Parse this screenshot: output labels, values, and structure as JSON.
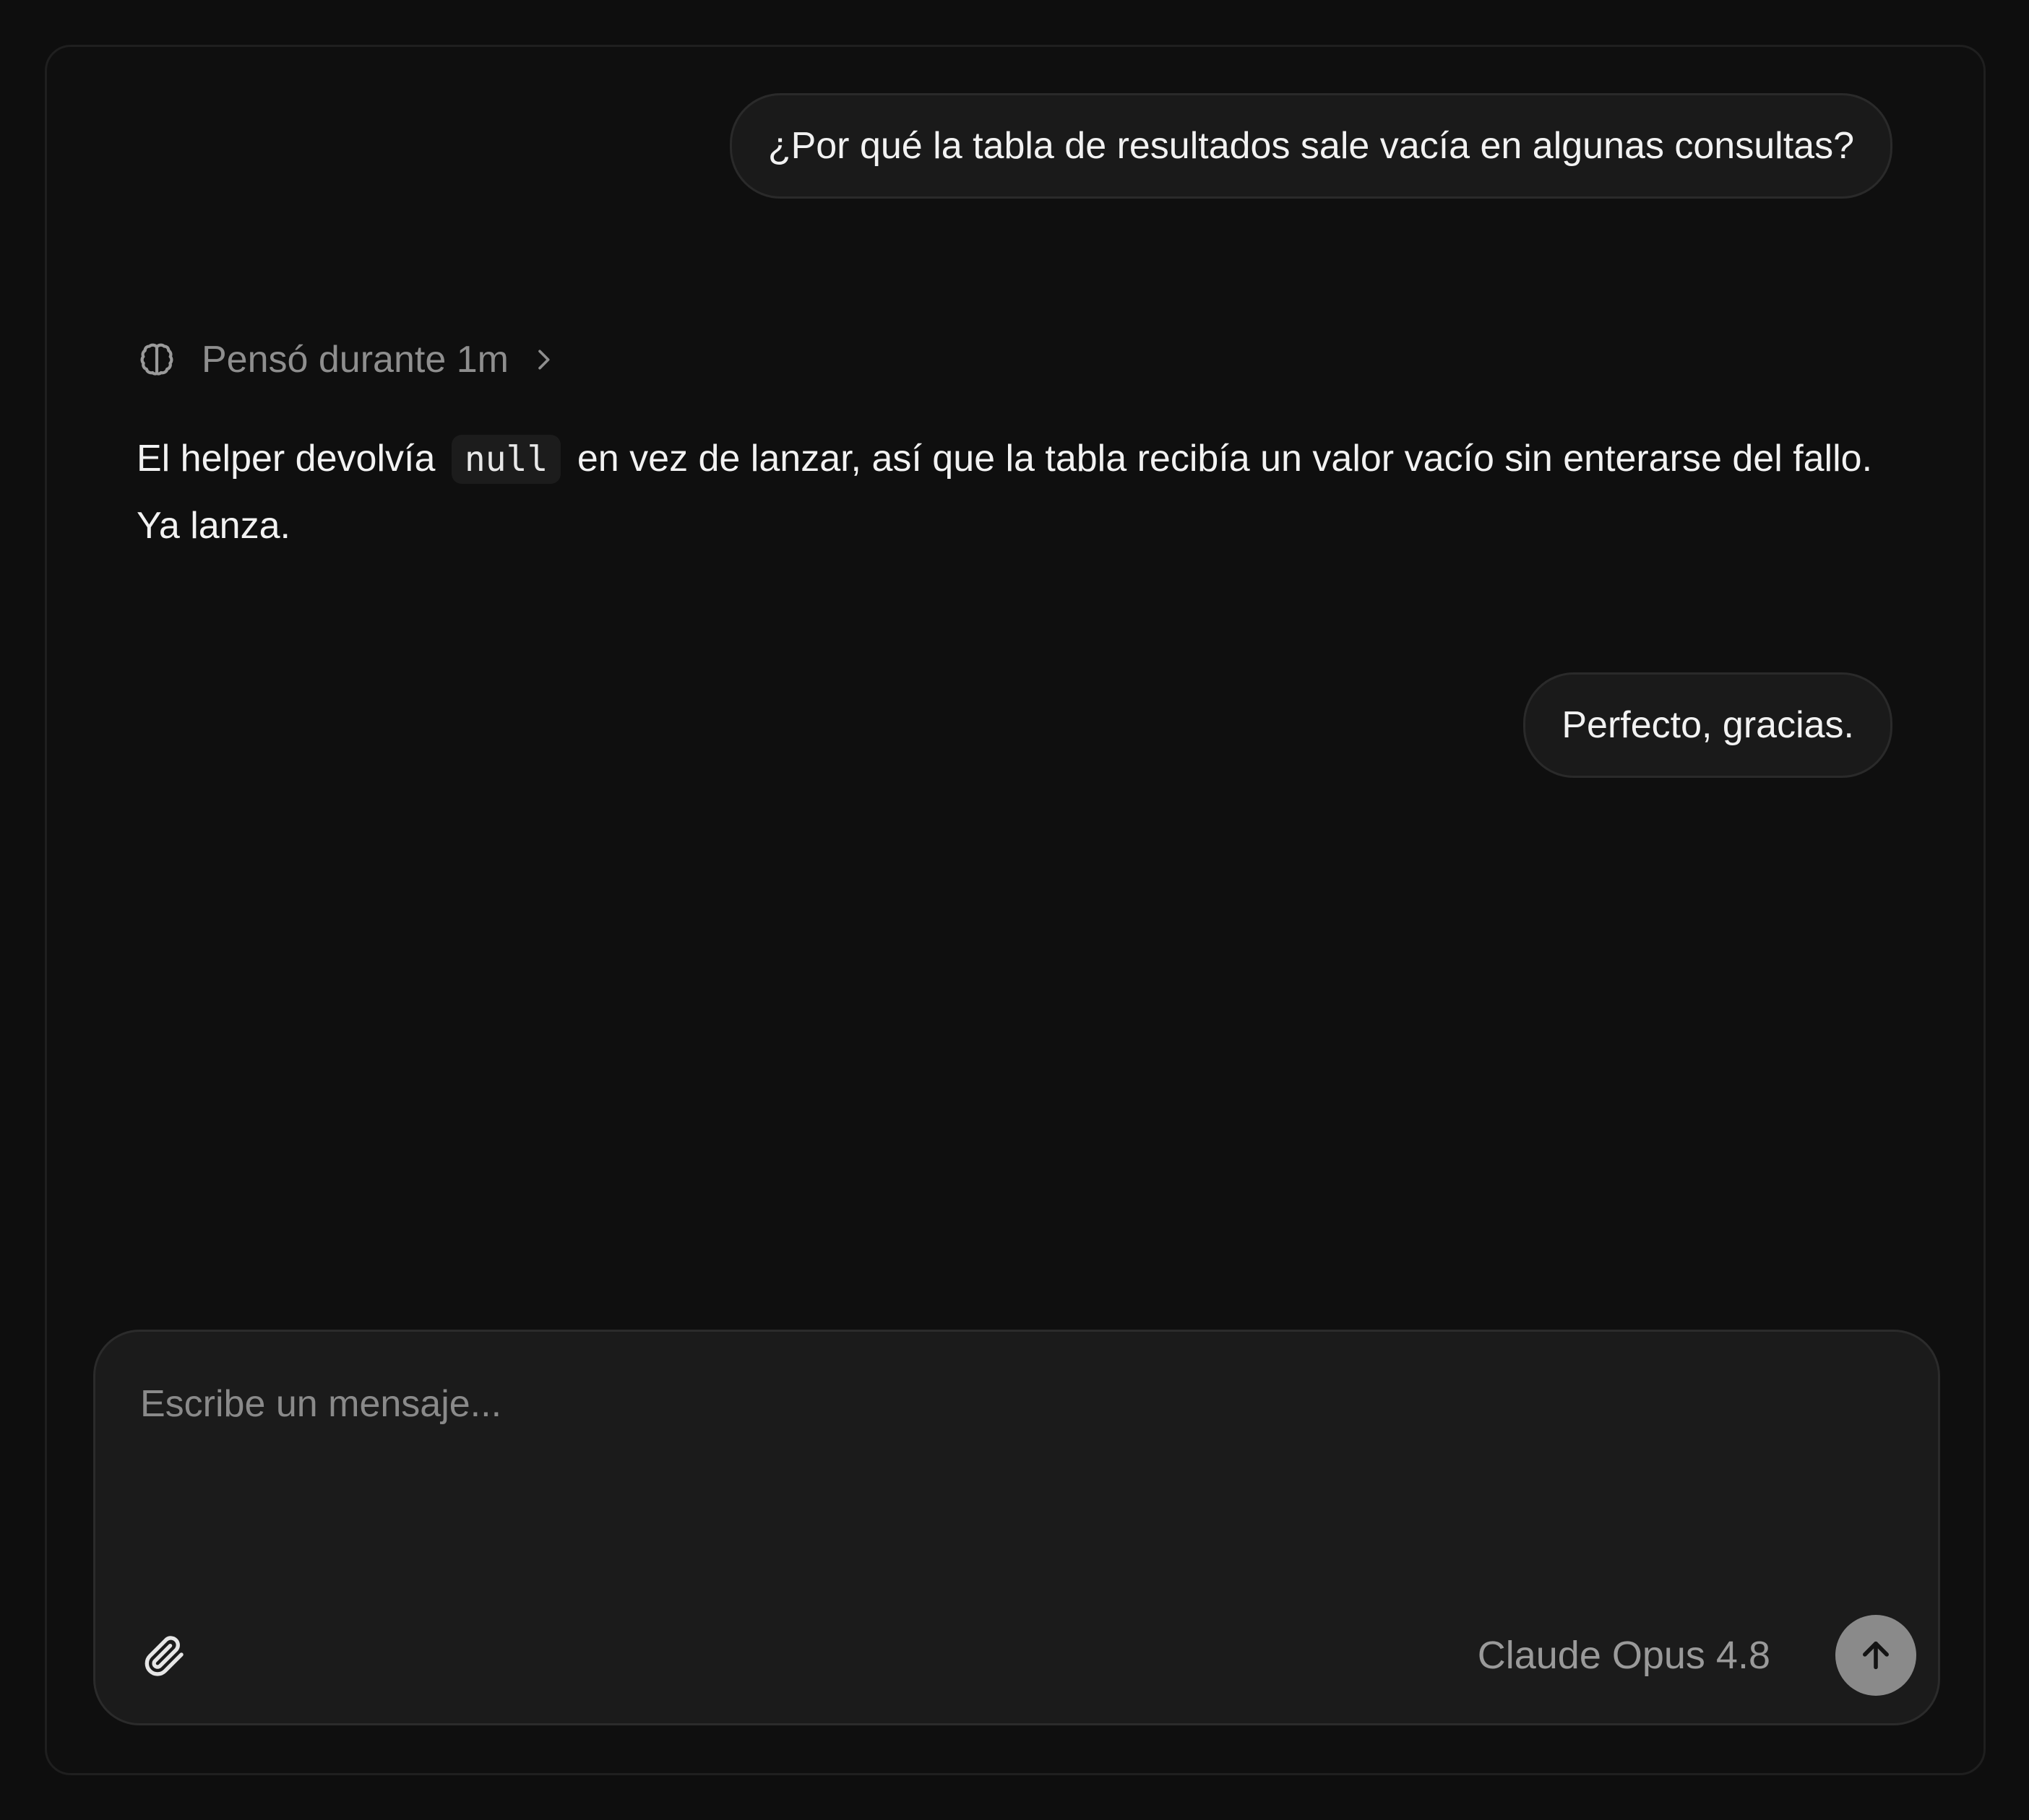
{
  "conversation": {
    "question_1": "¿Por qué la tabla de resultados sale vacía en algunas consultas?",
    "thinking": {
      "label": "Pensó durante 1m",
      "icon": "brain-icon",
      "expand_icon": "chevron-right-icon"
    },
    "answer": {
      "before_code": "El helper devolvía",
      "code": "null",
      "after_code": "en vez de lanzar, así que la tabla recibía un valor vacío sin enterarse del fallo. Ya lanza."
    },
    "question_2": "Perfecto, gracias."
  },
  "composer": {
    "placeholder": "Escribe un mensaje...",
    "value": "",
    "attach_icon": "paperclip-icon",
    "model_label": "Claude Opus 4.8",
    "send_icon": "arrow-up-icon"
  },
  "colors": {
    "background": "#0e0e0e",
    "bubble": "#1a1a1a",
    "composer": "#1b1b1b",
    "muted_text": "#8e8e8e",
    "send_button": "#8a8a8a"
  }
}
